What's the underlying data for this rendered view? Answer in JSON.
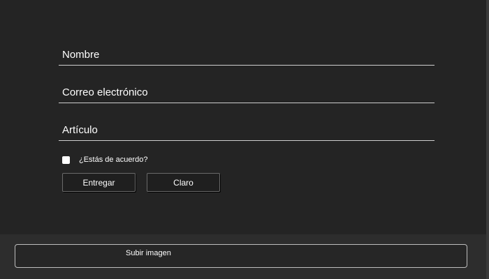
{
  "form": {
    "fields": {
      "name": {
        "placeholder": "Nombre",
        "value": ""
      },
      "email": {
        "placeholder": "Correo electrónico",
        "value": ""
      },
      "article": {
        "placeholder": "Artículo",
        "value": ""
      }
    },
    "agree_label": "¿Estás de acuerdo?",
    "agree_checked": false,
    "submit_label": "Entregar",
    "clear_label": "Claro"
  },
  "upload": {
    "label": "Subir imagen"
  },
  "colors": {
    "form_background": "#242424",
    "page_background": "#2d2d2d",
    "text": "#ffffff",
    "field_underline": "#cfcfcf"
  }
}
